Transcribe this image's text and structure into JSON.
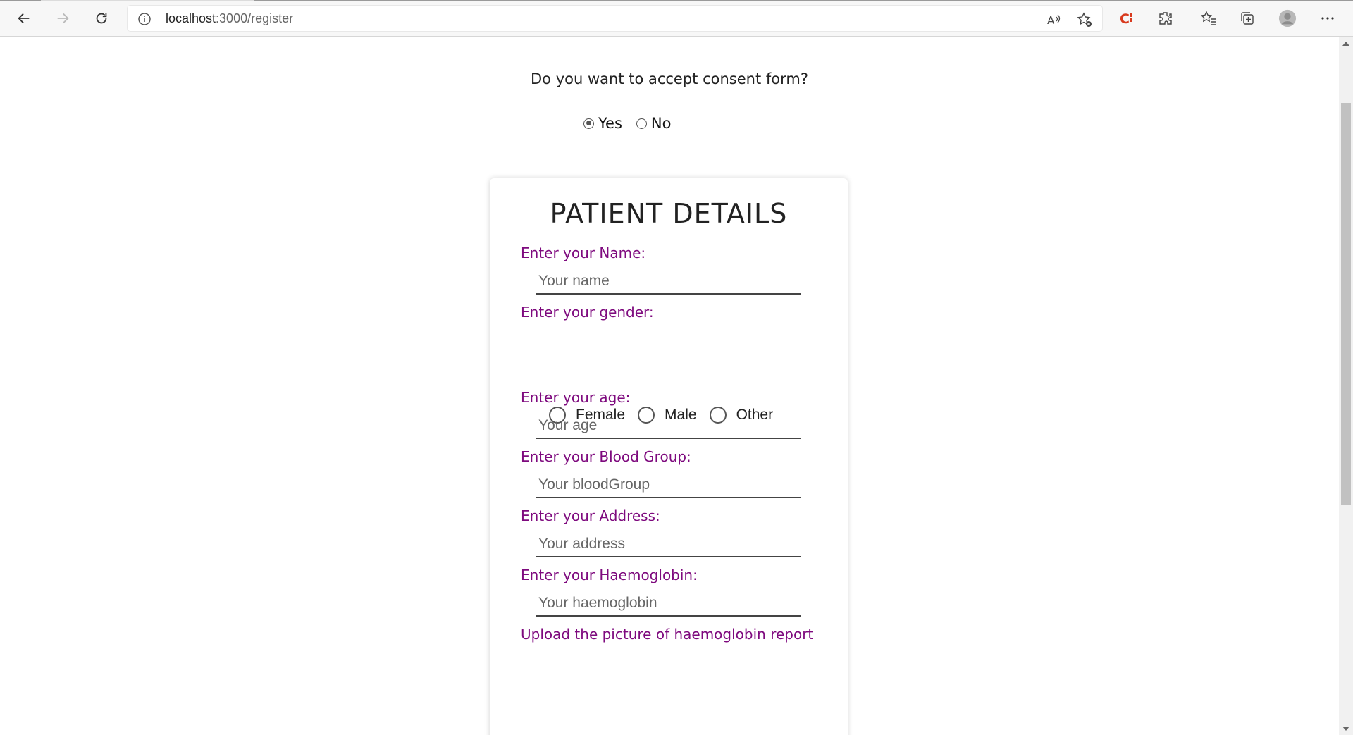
{
  "browser": {
    "url_host": "localhost",
    "url_rest": ":3000/register"
  },
  "consent": {
    "question": "Do you want to accept consent form?",
    "options": [
      {
        "label": "Yes",
        "checked": true
      },
      {
        "label": "No",
        "checked": false
      }
    ]
  },
  "form": {
    "title": "PATIENT DETAILS",
    "name_label": "Enter your Name:",
    "name_placeholder": "Your name",
    "gender_label": "Enter your gender:",
    "gender_options": [
      "Female",
      "Male",
      "Other"
    ],
    "age_label": "Enter your age:",
    "age_placeholder": "Your age",
    "blood_label": "Enter your Blood Group:",
    "blood_placeholder": "Your bloodGroup",
    "address_label": "Enter your Address:",
    "address_placeholder": "Your address",
    "haemo_label": "Enter your Haemoglobin:",
    "haemo_placeholder": "Your haemoglobin",
    "upload_label": "Upload the picture of haemoglobin report"
  },
  "colors": {
    "label": "#7e0a7e",
    "title": "#222222"
  }
}
